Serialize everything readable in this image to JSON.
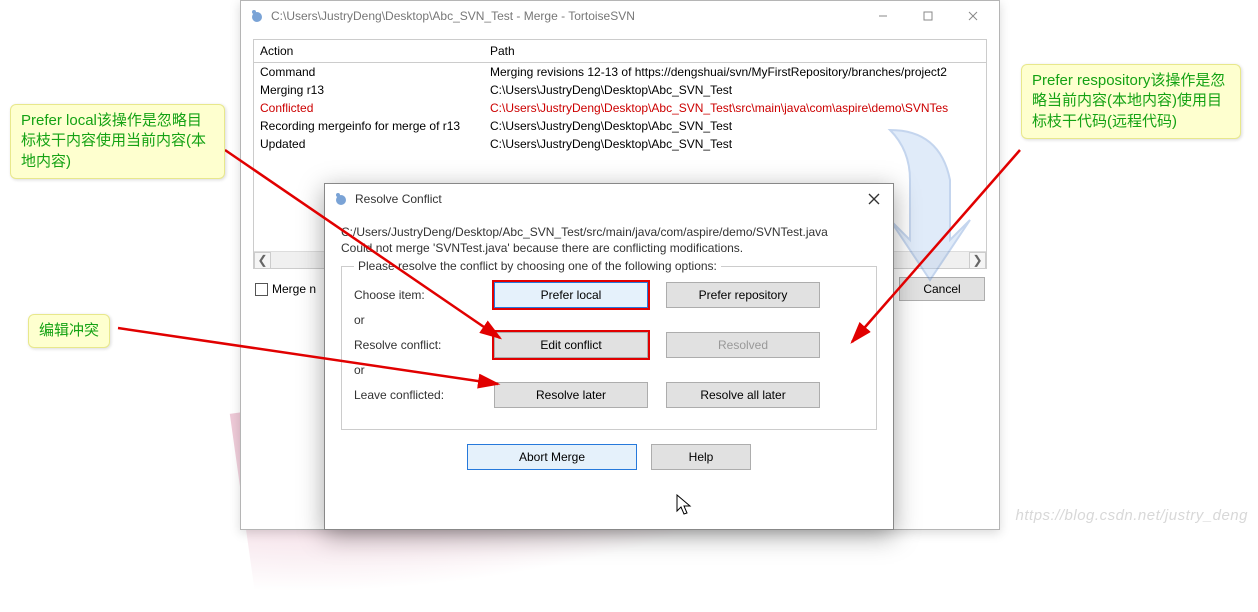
{
  "main_window": {
    "title": "C:\\Users\\JustryDeng\\Desktop\\Abc_SVN_Test - Merge - TortoiseSVN",
    "table": {
      "headers": {
        "action": "Action",
        "path": "Path"
      },
      "rows": [
        {
          "action": "Command",
          "path": "Merging revisions 12-13 of https://dengshuai/svn/MyFirstRepository/branches/project2",
          "cls": ""
        },
        {
          "action": "Merging r13",
          "path": "C:\\Users\\JustryDeng\\Desktop\\Abc_SVN_Test",
          "cls": ""
        },
        {
          "action": "Conflicted",
          "path": "C:\\Users\\JustryDeng\\Desktop\\Abc_SVN_Test\\src\\main\\java\\com\\aspire\\demo\\SVNTes",
          "cls": "conflicted"
        },
        {
          "action": "Recording mergeinfo for merge of r13",
          "path": "C:\\Users\\JustryDeng\\Desktop\\Abc_SVN_Test",
          "cls": ""
        },
        {
          "action": "Updated",
          "path": "C:\\Users\\JustryDeng\\Desktop\\Abc_SVN_Test",
          "cls": ""
        }
      ]
    },
    "merge_checkbox": "Merge n",
    "cancel": "Cancel"
  },
  "dialog": {
    "title": "Resolve Conflict",
    "path_line": "C:/Users/JustryDeng/Desktop/Abc_SVN_Test/src/main/java/com/aspire/demo/SVNTest.java",
    "msg_line": "Could not merge 'SVNTest.java' because there are conflicting modifications.",
    "legend": "Please resolve the conflict by choosing one of the following options:",
    "rows": {
      "choose_item": "Choose item:",
      "resolve_conflict": "Resolve conflict:",
      "leave_conflicted": "Leave conflicted:"
    },
    "or": "or",
    "buttons": {
      "prefer_local": "Prefer local",
      "prefer_repository": "Prefer repository",
      "edit_conflict": "Edit conflict",
      "resolved": "Resolved",
      "resolve_later": "Resolve later",
      "resolve_all_later": "Resolve all later",
      "abort_merge": "Abort Merge",
      "help": "Help"
    }
  },
  "notes": {
    "left": "Prefer local该操作是忽略目标枝干内容使用当前内容(本地内容)",
    "right": "Prefer respository该操作是忽略当前内容(本地内容)使用目标枝干代码(远程代码)",
    "edit": "编辑冲突"
  },
  "watermark": "https://blog.csdn.net/justry_deng"
}
